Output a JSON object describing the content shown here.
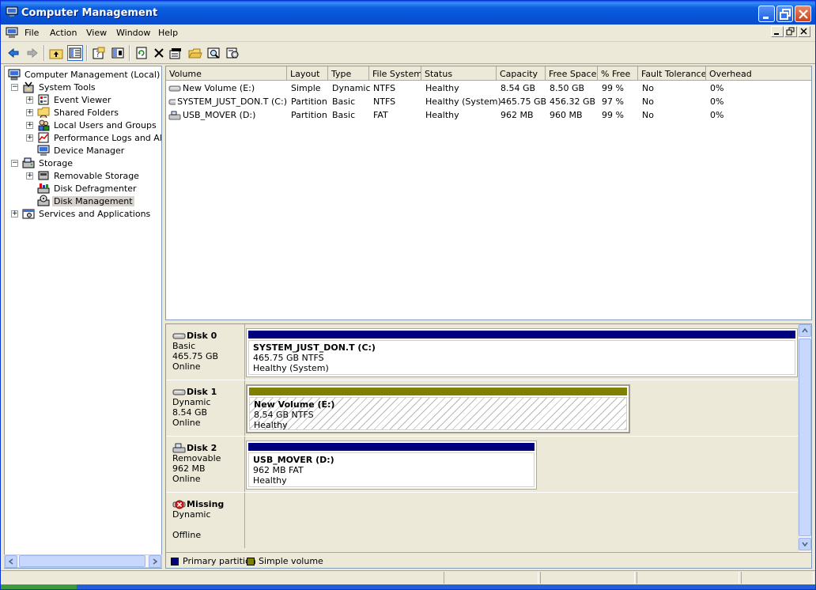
{
  "window": {
    "title": "Computer Management"
  },
  "menubar": {
    "items": [
      "File",
      "Action",
      "View",
      "Window",
      "Help"
    ]
  },
  "toolbar": {
    "icons": [
      "back-arrow-icon",
      "forward-arrow-icon",
      "up-folder-icon",
      "show-hide-tree-icon",
      "properties-icon",
      "help-icon",
      "refresh-icon",
      "delete-icon",
      "properties-sheet-icon",
      "open-folder-icon",
      "search-icon",
      "settings-icon"
    ]
  },
  "tree": {
    "root": "Computer Management (Local)",
    "system_tools": "System Tools",
    "event_viewer": "Event Viewer",
    "shared_folders": "Shared Folders",
    "local_users": "Local Users and Groups",
    "perf_logs": "Performance Logs and Alerts",
    "device_manager": "Device Manager",
    "storage": "Storage",
    "removable_storage": "Removable Storage",
    "disk_defrag": "Disk Defragmenter",
    "disk_management": "Disk Management",
    "services_apps": "Services and Applications"
  },
  "volume_list": {
    "columns": [
      "Volume",
      "Layout",
      "Type",
      "File System",
      "Status",
      "Capacity",
      "Free Space",
      "% Free",
      "Fault Tolerance",
      "Overhead"
    ],
    "rows": [
      {
        "volume": "New Volume (E:)",
        "layout": "Simple",
        "type": "Dynamic",
        "fs": "NTFS",
        "status": "Healthy",
        "capacity": "8.54 GB",
        "free": "8.50 GB",
        "pct": "99 %",
        "fault": "No",
        "overhead": "0%"
      },
      {
        "volume": "SYSTEM_JUST_DON.T (C:)",
        "layout": "Partition",
        "type": "Basic",
        "fs": "NTFS",
        "status": "Healthy (System)",
        "capacity": "465.75 GB",
        "free": "456.32 GB",
        "pct": "97 %",
        "fault": "No",
        "overhead": "0%"
      },
      {
        "volume": "USB_MOVER (D:)",
        "layout": "Partition",
        "type": "Basic",
        "fs": "FAT",
        "status": "Healthy",
        "capacity": "962 MB",
        "free": "960 MB",
        "pct": "99 %",
        "fault": "No",
        "overhead": "0%"
      }
    ]
  },
  "disks": [
    {
      "name": "Disk 0",
      "type": "Basic",
      "size": "465.75 GB",
      "state": "Online",
      "partition": {
        "name": "SYSTEM_JUST_DON.T  (C:)",
        "detail": "465.75 GB NTFS",
        "status": "Healthy (System)",
        "color": "#00007f"
      }
    },
    {
      "name": "Disk 1",
      "type": "Dynamic",
      "size": "8.54 GB",
      "state": "Online",
      "partition": {
        "name": "New Volume  (E:)",
        "detail": "8.54 GB NTFS",
        "status": "Healthy",
        "color": "#808000"
      }
    },
    {
      "name": "Disk 2",
      "type": "Removable",
      "size": "962 MB",
      "state": "Online",
      "partition": {
        "name": "USB_MOVER  (D:)",
        "detail": "962 MB FAT",
        "status": "Healthy",
        "color": "#00007f"
      }
    },
    {
      "name": "Missing",
      "type": "Dynamic",
      "size": "",
      "state": "Offline"
    }
  ],
  "legend": {
    "primary": {
      "label": "Primary partition",
      "color": "#00007f"
    },
    "simple": {
      "label": "Simple volume",
      "color": "#808000"
    }
  }
}
